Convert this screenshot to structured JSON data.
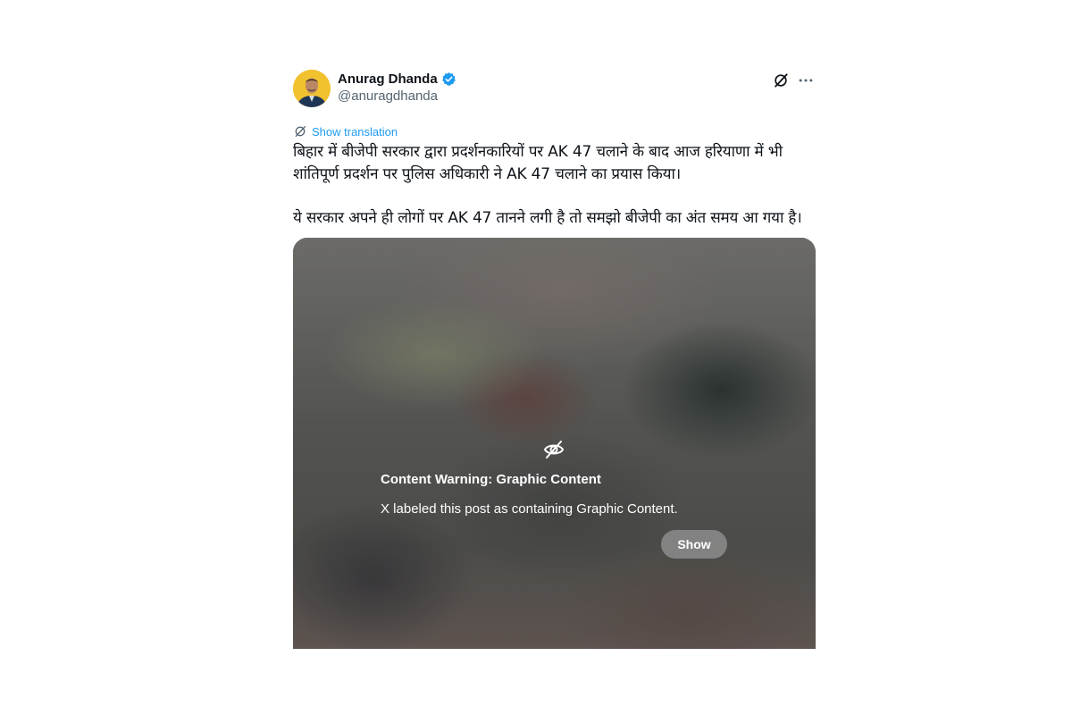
{
  "author": {
    "display_name": "Anurag Dhanda",
    "handle": "@anuragdhanda",
    "verified": true
  },
  "icons": {
    "verified": "verified-badge-icon",
    "grok": "grok-icon",
    "more": "more-icon",
    "translate": "translate-icon",
    "hidden": "eye-off-icon"
  },
  "tweet": {
    "translate_label": "Show translation",
    "text": "बिहार में बीजेपी सरकार द्वारा प्रदर्शनकारियों पर AK 47 चलाने के बाद आज हरियाणा में भी शांतिपूर्ण प्रदर्शन पर पुलिस अधिकारी ने AK 47 चलाने का प्रयास किया।\n\nये सरकार अपने ही लोगों पर AK 47 तानने लगी है तो समझो बीजेपी का अंत समय आ गया है।"
  },
  "media": {
    "warning_title": "Content Warning: Graphic Content",
    "warning_text": "X labeled this post as containing Graphic Content.",
    "show_label": "Show"
  },
  "colors": {
    "link": "#1d9bf0",
    "verified": "#1d9bf0",
    "text": "#0f1419",
    "secondary": "#536471"
  }
}
